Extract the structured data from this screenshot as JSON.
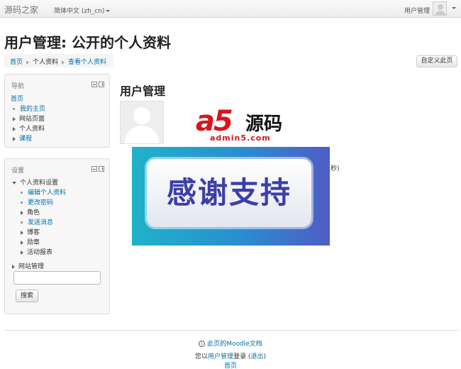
{
  "navbar": {
    "brand": "源码之家",
    "language": "简体中文 (zh_cn)",
    "user_menu": "用户管理"
  },
  "header": {
    "title": "用户管理: 公开的个人资料",
    "breadcrumb": [
      "首页",
      "个人资料",
      "查看个人资料"
    ],
    "customize_button": "自定义此页"
  },
  "nav_block": {
    "title": "导航",
    "items": [
      {
        "label": "首页",
        "type": "link"
      },
      {
        "label": "我的主页",
        "type": "link"
      },
      {
        "label": "网站页面",
        "type": "branch"
      },
      {
        "label": "个人资料",
        "type": "branch"
      },
      {
        "label": "课程",
        "type": "link-branch"
      }
    ]
  },
  "settings_block": {
    "title": "设置",
    "profile_settings": "个人资料设置",
    "items": [
      {
        "label": "编辑个人资料",
        "type": "link"
      },
      {
        "label": "更改密码",
        "type": "link"
      },
      {
        "label": "角色",
        "type": "branch"
      },
      {
        "label": "发送消息",
        "type": "link"
      },
      {
        "label": "博客",
        "type": "branch"
      },
      {
        "label": "勋章",
        "type": "branch"
      },
      {
        "label": "活动报表",
        "type": "branch"
      }
    ],
    "site_admin": "网站管理",
    "search_placeholder": "",
    "search_button": "搜索"
  },
  "main": {
    "heading": "用户管理",
    "partial_text": "秒)",
    "watermark": {
      "logo": "a5",
      "text": "源码",
      "url": "admin5.com"
    },
    "banner_text": "感谢支持"
  },
  "footer": {
    "doc_link": "此页的Moodle文档",
    "login_prefix": "您以",
    "login_user": "用户管理",
    "login_middle": "登录 (",
    "logout": "退出",
    "login_suffix": ")",
    "home": "首页"
  },
  "colors": {
    "link": "#0070a8",
    "brand_red": "#d9141b",
    "banner_text": "#3c3fa8"
  }
}
